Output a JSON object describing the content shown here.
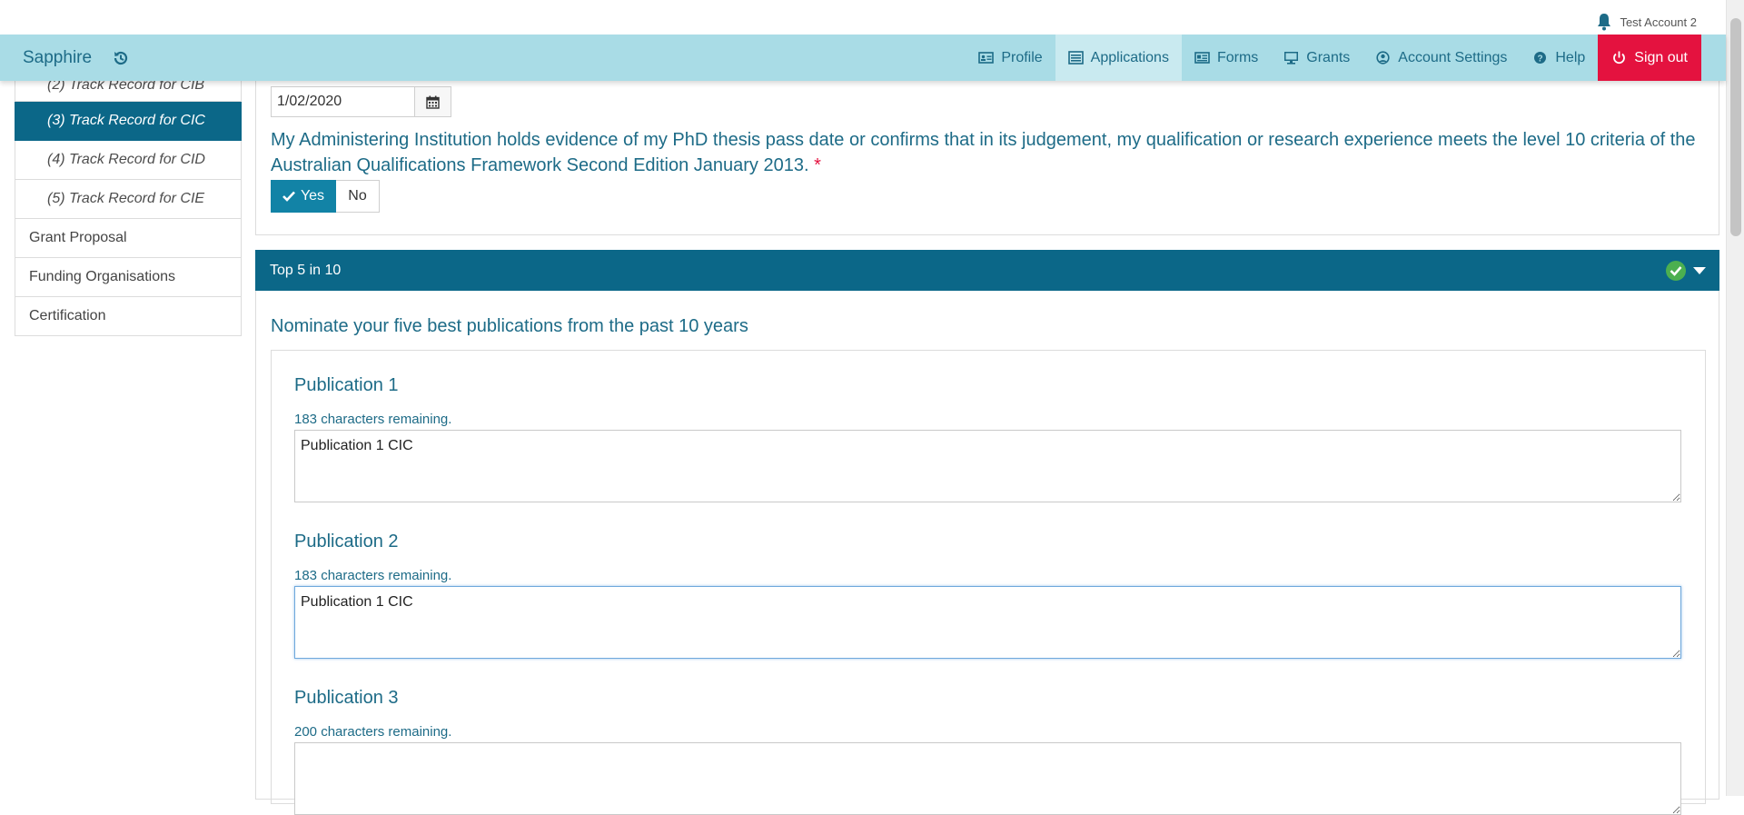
{
  "topbar": {
    "account_name": "Test Account 2"
  },
  "navbar": {
    "brand": "Sapphire",
    "links": [
      {
        "label": "Profile",
        "icon": "id-card-icon"
      },
      {
        "label": "Applications",
        "icon": "list-icon",
        "active": true
      },
      {
        "label": "Forms",
        "icon": "newspaper-icon"
      },
      {
        "label": "Grants",
        "icon": "monitor-icon"
      },
      {
        "label": "Account Settings",
        "icon": "user-circle-icon"
      },
      {
        "label": "Help",
        "icon": "question-circle-icon"
      }
    ],
    "signout_label": "Sign out"
  },
  "sidebar": {
    "items": [
      {
        "label": "(2) Track Record for CIB"
      },
      {
        "label": "(3) Track Record for CIC",
        "active": true
      },
      {
        "label": "(4) Track Record for CID"
      },
      {
        "label": "(5) Track Record for CIE"
      },
      {
        "label": "Grant Proposal"
      },
      {
        "label": "Funding Organisations"
      },
      {
        "label": "Certification"
      }
    ]
  },
  "form": {
    "date_value": "1/02/2020",
    "question": "My Administering Institution holds evidence of my PhD thesis pass date or confirms that in its judgement, my qualification or research experience meets the level 10 criteria of the Australian Qualifications Framework Second Edition January 2013.",
    "required_marker": "*",
    "yes_label": "Yes",
    "no_label": "No",
    "selected": "Yes"
  },
  "section": {
    "title": "Top 5 in 10",
    "status_color": "#4caf50",
    "nominate_text": "Nominate your five best publications from the past 10 years",
    "publications": [
      {
        "title": "Publication 1",
        "remaining": "183 characters remaining.",
        "value": "Publication 1 CIC"
      },
      {
        "title": "Publication 2",
        "remaining": "183 characters remaining.",
        "value": "Publication 1 CIC"
      },
      {
        "title": "Publication 3",
        "remaining": "200 characters remaining.",
        "value": ""
      }
    ]
  },
  "colors": {
    "navbar_bg": "#a9dce6",
    "primary": "#0b6788",
    "signout_bg": "#e4123f",
    "text_accent": "#1d6b87"
  }
}
